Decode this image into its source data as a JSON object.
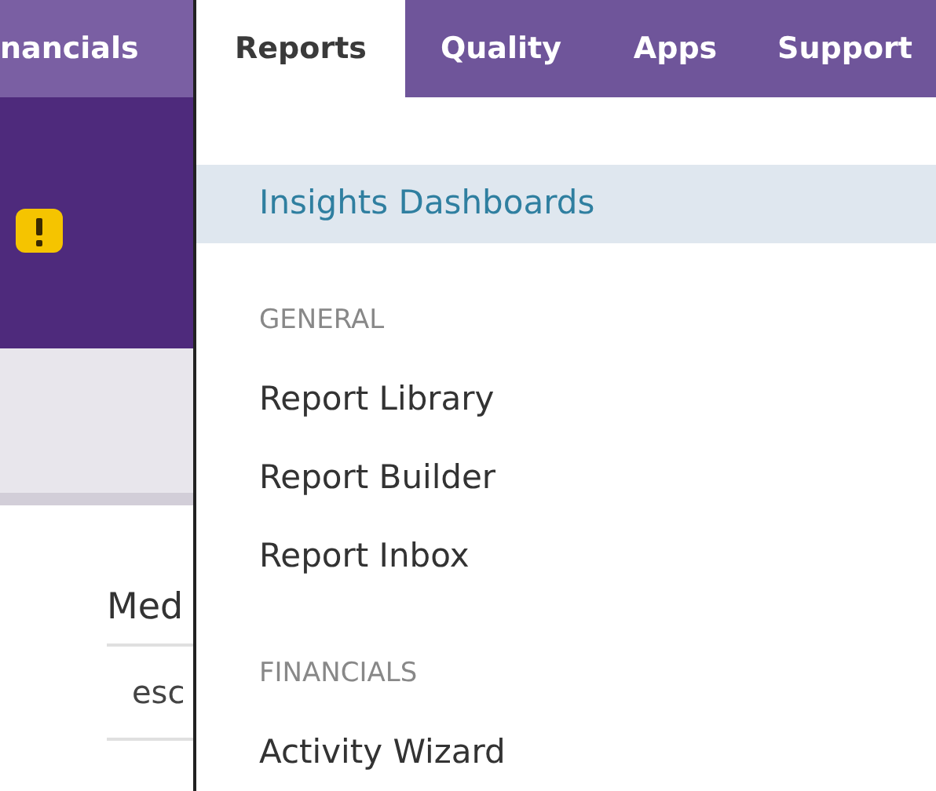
{
  "tabs": [
    {
      "label": "nancials",
      "selected": false
    },
    {
      "label": "Reports",
      "selected": true
    },
    {
      "label": "Quality",
      "selected": false
    },
    {
      "label": "Apps",
      "selected": false
    },
    {
      "label": "Support",
      "selected": false
    }
  ],
  "background": {
    "heading": "Med",
    "rows": [
      "esc"
    ]
  },
  "menu": {
    "items": [
      {
        "kind": "item",
        "label": "Insights Dashboards",
        "selected": true
      },
      {
        "kind": "header",
        "label": "GENERAL"
      },
      {
        "kind": "item",
        "label": "Report Library",
        "selected": false
      },
      {
        "kind": "item",
        "label": "Report Builder",
        "selected": false
      },
      {
        "kind": "item",
        "label": "Report Inbox",
        "selected": false
      },
      {
        "kind": "header",
        "label": "FINANCIALS"
      },
      {
        "kind": "item",
        "label": "Activity Wizard",
        "selected": false
      }
    ]
  }
}
